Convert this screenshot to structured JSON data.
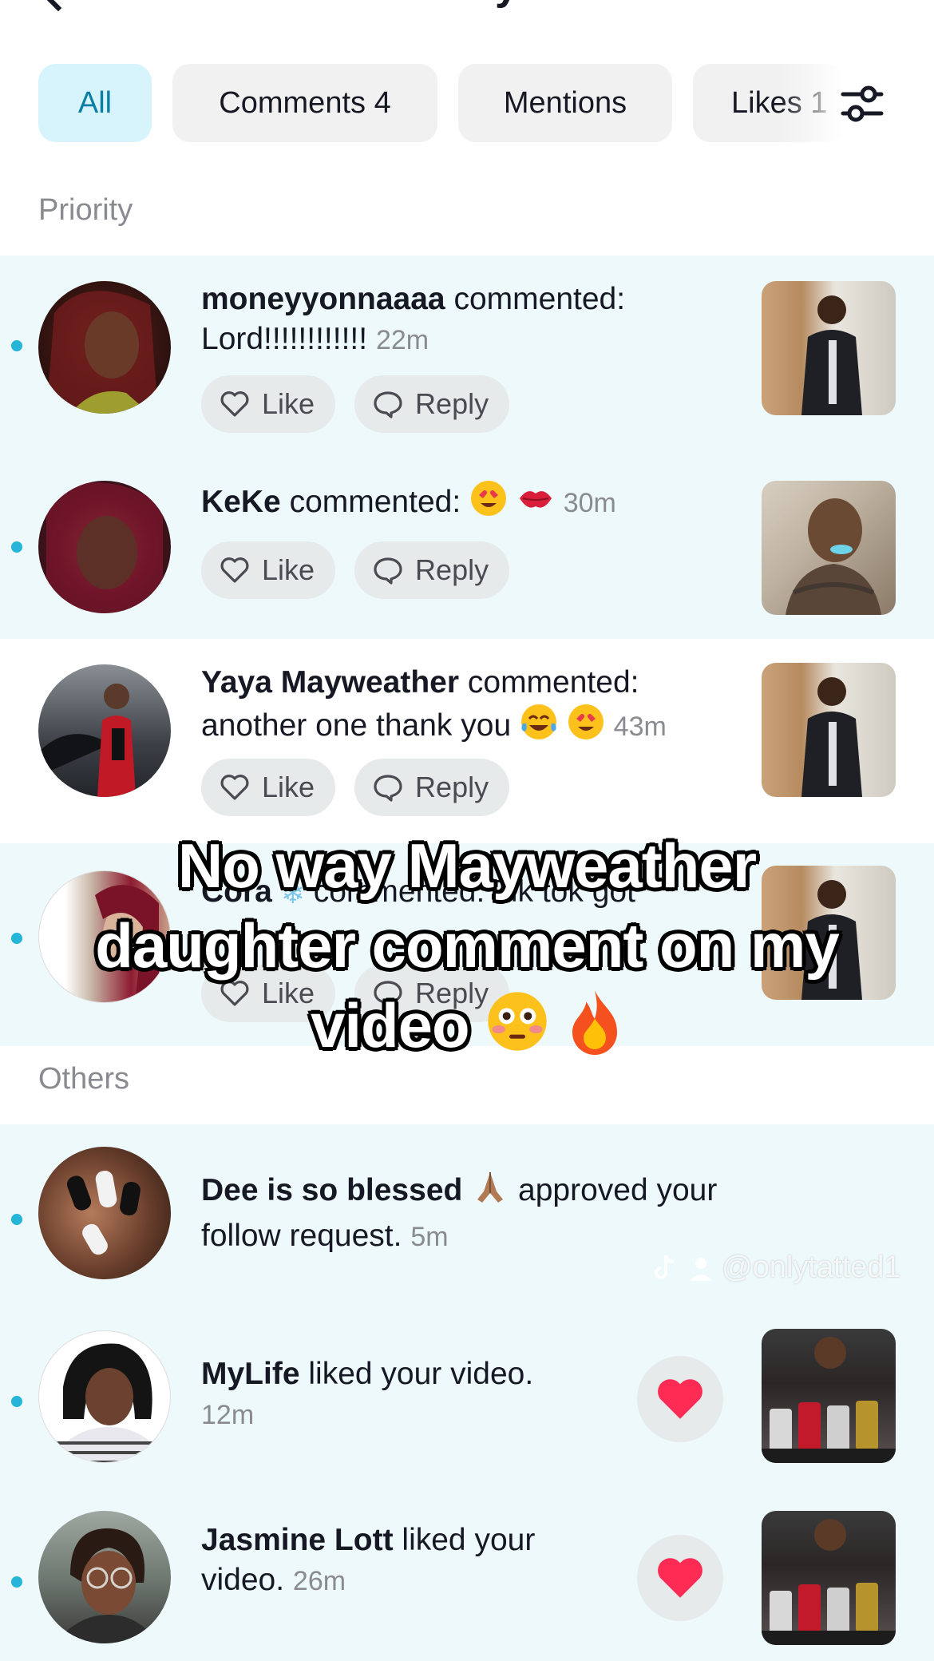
{
  "header": {
    "title_fragment": "y"
  },
  "filters": [
    {
      "label": "All",
      "active": true
    },
    {
      "label": "Comments 4",
      "active": false
    },
    {
      "label": "Mentions",
      "active": false
    },
    {
      "label": "Likes 1",
      "active": false
    }
  ],
  "sections": {
    "priority": "Priority",
    "others": "Others"
  },
  "actions": {
    "like": "Like",
    "reply": "Reply"
  },
  "priority_items": [
    {
      "user": "moneyyonnaaaa",
      "verb": "commented:",
      "text": "Lord!!!!!!!!!!!!",
      "time": "22m",
      "unread": true
    },
    {
      "user": "KeKe",
      "verb": "commented:",
      "text": "",
      "time": "30m",
      "unread": true
    },
    {
      "user": "Yaya Mayweather",
      "verb": "commented:",
      "text": "another one thank you",
      "time": "43m",
      "unread": false
    },
    {
      "user": "Cora",
      "verb": "commented:",
      "text": "Tik tok got",
      "time": "",
      "unread": true
    }
  ],
  "other_items": [
    {
      "user": "Dee is so blessed",
      "verb": "approved your follow request.",
      "time": "5m",
      "unread": true
    },
    {
      "user": "MyLife",
      "verb": "liked your video.",
      "time": "12m",
      "unread": true
    },
    {
      "user": "Jasmine Lott",
      "verb": "liked your video.",
      "time": "26m",
      "unread": true
    }
  ],
  "overlay_caption": {
    "line1": "No way Mayweather",
    "line2": "daughter comment on my",
    "line3": "video"
  },
  "watermark": "@onlytatted1",
  "colors": {
    "accent": "#25b5d8",
    "active_chip_bg": "#d7f3fb",
    "priority_band": "#eef9fc",
    "heart": "#fe2c55"
  }
}
